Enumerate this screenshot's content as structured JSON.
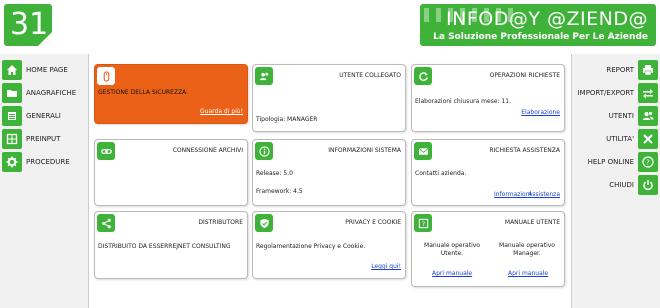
{
  "colors": {
    "accent": "#3fb339",
    "orange": "#ea6117",
    "link": "#1a3fd1"
  },
  "header": {
    "logo_text": "31",
    "brand_title": "INFOD@Y @ZIEND@",
    "brand_subtitle": "La Soluzione Professionale Per Le Aziende"
  },
  "left_nav": [
    {
      "label": "HOME PAGE",
      "icon": "home-icon"
    },
    {
      "label": "ANAGRAFICHE",
      "icon": "folder-icon"
    },
    {
      "label": "GENERALI",
      "icon": "list-icon"
    },
    {
      "label": "PREINPUT",
      "icon": "table-icon"
    },
    {
      "label": "PROCEDURE",
      "icon": "gear-icon"
    }
  ],
  "right_nav": [
    {
      "label": "REPORT",
      "icon": "printer-icon"
    },
    {
      "label": "IMPORT/EXPORT",
      "icon": "arrows-icon"
    },
    {
      "label": "UTENTI",
      "icon": "users-icon"
    },
    {
      "label": "UTILITA'",
      "icon": "tools-icon"
    },
    {
      "label": "HELP ONLINE",
      "icon": "help-icon"
    },
    {
      "label": "CHIUDI",
      "icon": "power-icon"
    }
  ],
  "cards": {
    "sicurezza": {
      "text": "GESTIONE DELLA SICUREZZA.",
      "link": "Guarda di più!"
    },
    "utente": {
      "title": "UTENTE COLLEGATO",
      "text": "Tipologia: MANAGER"
    },
    "operazioni": {
      "title": "OPERAZIONI RICHIESTE",
      "text": "Elaborazioni chiusura mese: 11.",
      "link": "Elaborazione"
    },
    "connessione": {
      "title": "CONNESSIONE ARCHIVI"
    },
    "sistema": {
      "title": "INFORMAZIONI SISTEMA",
      "release": "Release: 5.0",
      "framework": "Framework: 4.5"
    },
    "assistenza": {
      "title": "RICHIESTA ASSISTENZA",
      "text": "Contatti azienda.",
      "link1": "Informazioni",
      "link2": "Assistenza"
    },
    "distributore": {
      "title": "DISTRIBUTORE",
      "text": "DISTRIBUITO DA ESSERREJNET CONSULTING"
    },
    "privacy": {
      "title": "PRIVACY E COOKIE",
      "text": "Regolamentazione Privacy e Cookie.",
      "link": "Leggi qui!"
    },
    "manuale": {
      "title": "MANUALE UTENTE",
      "col1_text": "Manuale operativo Utente.",
      "col1_link": "Apri manuale",
      "col2_text": "Manuale operativo Manager.",
      "col2_link": "Apri manuale"
    }
  }
}
